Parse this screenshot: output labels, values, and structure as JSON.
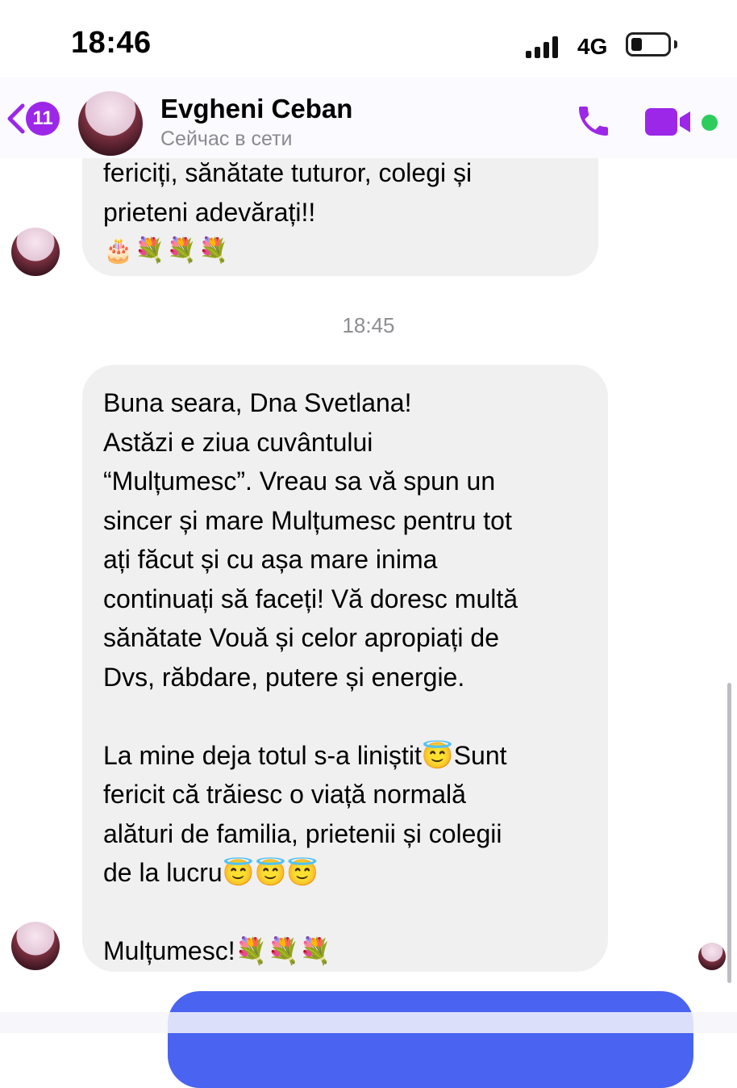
{
  "status_bar": {
    "time": "18:46",
    "network": "4G",
    "battery_level": 0.3
  },
  "header": {
    "back_badge": "11",
    "contact_name": "Evgheni Ceban",
    "contact_status": "Сейчас в сети",
    "accent_color": "#9c27e8",
    "online_color": "#2ecc5c"
  },
  "messages": {
    "previous": {
      "line1": "fericiți, sănătate tuturor, colegi și",
      "line2": "prieteni adevărați!!",
      "emojis": "🎂💐💐💐"
    },
    "separator_time": "18:45",
    "main": {
      "body": "Buna seara, Dna Svetlana!\nAstăzi e ziua cuvântului\n“Mulțumesc”. Vreau sa vă spun un\nsincer și mare Mulțumesc pentru tot\nați făcut și cu așa mare inima\ncontinuați să faceți! Vă doresc multă\nsănătate Vouă și celor apropiați de\nDvs, răbdare, putere și energie.\n\nLa mine deja totul s-a liniștit😇Sunt\nfericit că trăiesc o viață normală\nalături de familia, prietenii și colegii\nde la lucru😇😇😇\n\nMulțumesc!💐💐💐"
    }
  }
}
